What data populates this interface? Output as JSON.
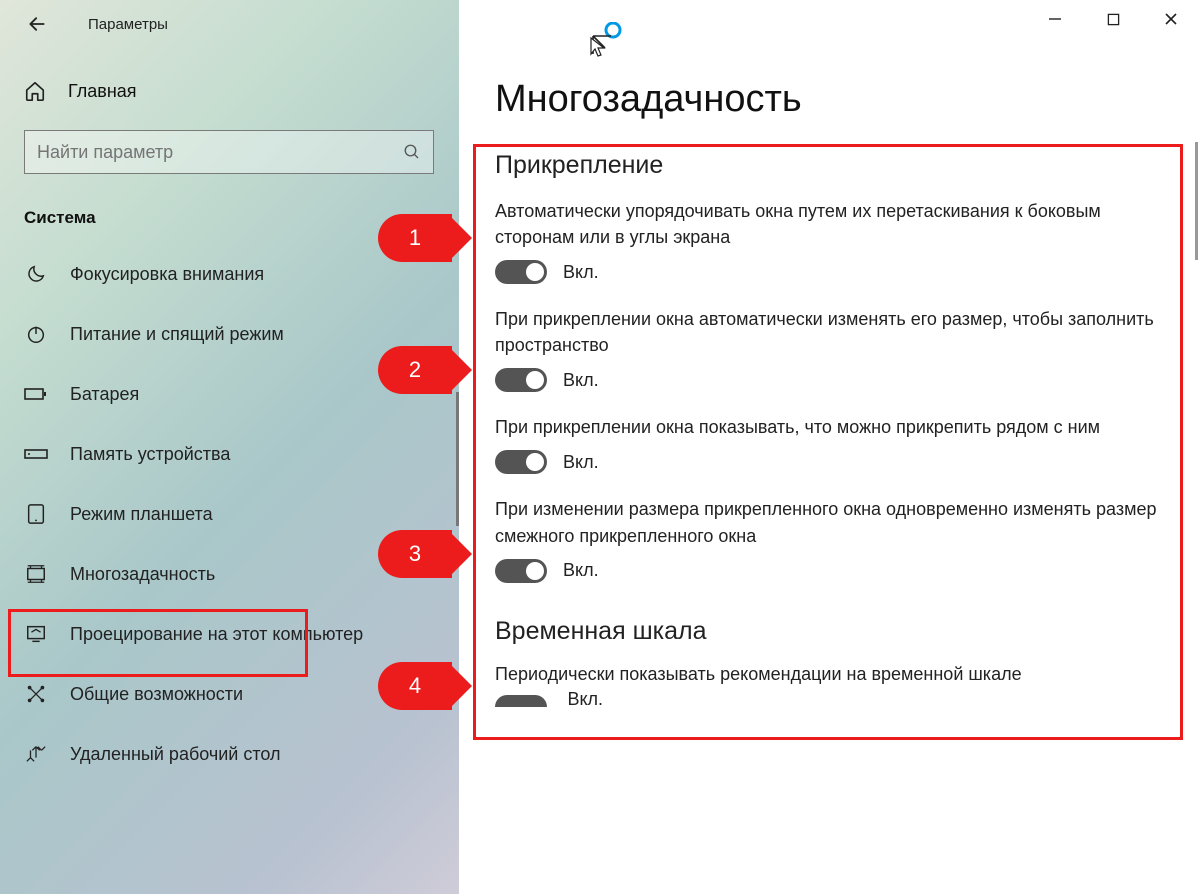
{
  "app_title": "Параметры",
  "home_label": "Главная",
  "search_placeholder": "Найти параметр",
  "section_title": "Система",
  "nav_items": [
    {
      "label": "Фокусировка внимания"
    },
    {
      "label": "Питание и спящий режим"
    },
    {
      "label": "Батарея"
    },
    {
      "label": "Память устройства"
    },
    {
      "label": "Режим планшета"
    },
    {
      "label": "Многозадачность"
    },
    {
      "label": "Проецирование на этот компьютер"
    },
    {
      "label": "Общие возможности"
    },
    {
      "label": "Удаленный рабочий стол"
    }
  ],
  "page_heading": "Многозадачность",
  "snap_section": {
    "title": "Прикрепление",
    "items": [
      {
        "desc": "Автоматически упорядочивать окна путем их перетаскивания к боковым сторонам или в углы экрана",
        "state_label": "Вкл."
      },
      {
        "desc": "При прикреплении окна автоматически изменять его размер, чтобы заполнить пространство",
        "state_label": "Вкл."
      },
      {
        "desc": "При прикреплении окна показывать, что можно прикрепить рядом с ним",
        "state_label": "Вкл."
      },
      {
        "desc": "При изменении размера прикрепленного окна одновременно изменять размер смежного прикрепленного окна",
        "state_label": "Вкл."
      }
    ]
  },
  "timeline_section": {
    "title": "Временная шкала",
    "desc": "Периодически показывать рекомендации на временной шкале",
    "state_label": "Вкл."
  },
  "callouts": [
    "1",
    "2",
    "3",
    "4"
  ]
}
